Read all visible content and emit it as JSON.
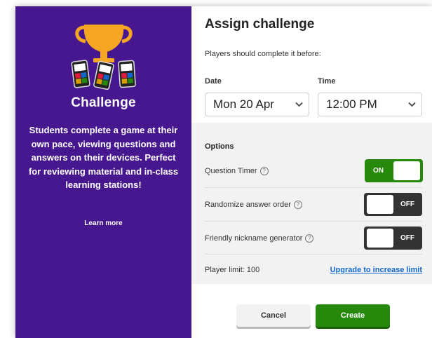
{
  "left_panel": {
    "title": "Challenge",
    "description": "Students complete a game at their own pace, viewing questions and answers on their devices. Perfect for reviewing material and in-class learning stations!",
    "learn_more": "Learn more",
    "background_color": "#46178f",
    "icons": [
      "trophy-icon",
      "phone-icon",
      "phone-icon",
      "phone-icon"
    ]
  },
  "dialog": {
    "title": "Assign challenge",
    "subtitle": "Players should complete it before:",
    "date": {
      "label": "Date",
      "value": "Mon 20 Apr"
    },
    "time": {
      "label": "Time",
      "value": "12:00 PM"
    }
  },
  "options": {
    "heading": "Options",
    "question_timer": {
      "label": "Question Timer",
      "state": "ON"
    },
    "randomize_order": {
      "label": "Randomize answer order",
      "state": "OFF"
    },
    "nickname_generator": {
      "label": "Friendly nickname generator",
      "state": "OFF"
    },
    "help_glyph": "?",
    "player_limit": "Player limit: 100",
    "upgrade_link": "Upgrade to increase limit"
  },
  "buttons": {
    "cancel": "Cancel",
    "create": "Create"
  },
  "colors": {
    "brand_purple": "#46178f",
    "toggle_on": "#26890c",
    "toggle_off": "#333333",
    "link_blue": "#1368ce",
    "create_button": "#26890c"
  }
}
